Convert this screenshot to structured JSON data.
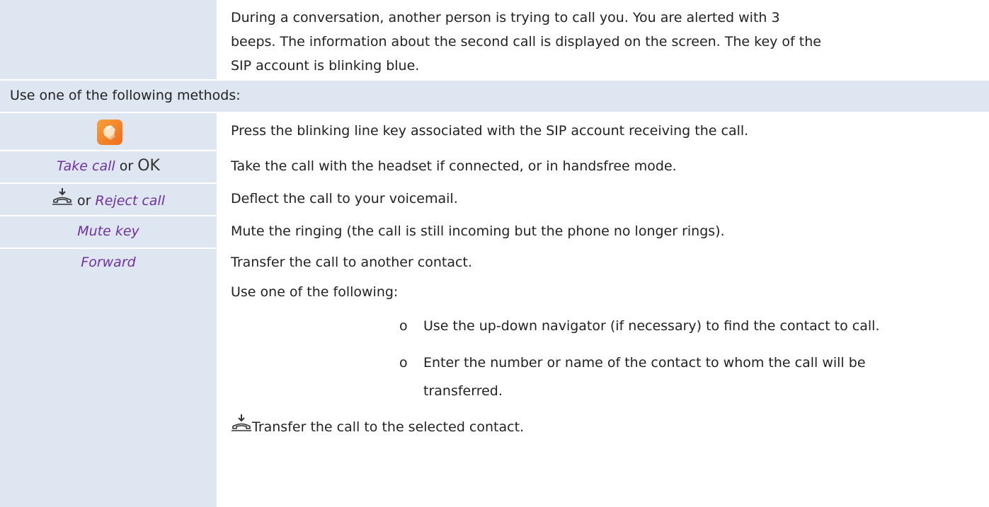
{
  "intro": {
    "line1": "During a conversation, another person is trying to call you. You are alerted with 3",
    "line2": "beeps. The information about the second call is displayed on the screen. The key of the",
    "line3": "SIP account is blinking blue."
  },
  "methods_header": "Use one of the following methods:",
  "rows": [
    {
      "icon": "sip-account-line-key-icon",
      "desc": "Press the blinking line key associated with the SIP account receiving the call."
    },
    {
      "key_label": "Take call",
      "connector": "or",
      "ok_label": "OK",
      "desc": "Take the call with the headset if connected, or in handsfree mode."
    },
    {
      "icon": "hang-up-icon",
      "connector": "or",
      "key_label": "Reject call",
      "desc": "Deflect the call to your voicemail."
    },
    {
      "key_label": "Mute key",
      "desc": "Mute the ringing (the call is still incoming but the phone no longer rings)."
    },
    {
      "key_label": "Forward",
      "desc": "Transfer the call to another contact.",
      "sub_intro": "Use one of the following:",
      "bullets": [
        {
          "marker": "o",
          "line1": "Use the up-down navigator (if necessary) to find the contact to call."
        },
        {
          "marker": "o",
          "line1": "Enter the number or name of the contact to whom the call will be",
          "line2": "transferred."
        }
      ],
      "final_icon": "hang-up-icon",
      "final_text": "Transfer the call to the selected contact."
    }
  ],
  "colors": {
    "label_purple": "#7030a0",
    "cell_blue": "#dde6f1",
    "icon_orange": "#ef6b1c"
  }
}
